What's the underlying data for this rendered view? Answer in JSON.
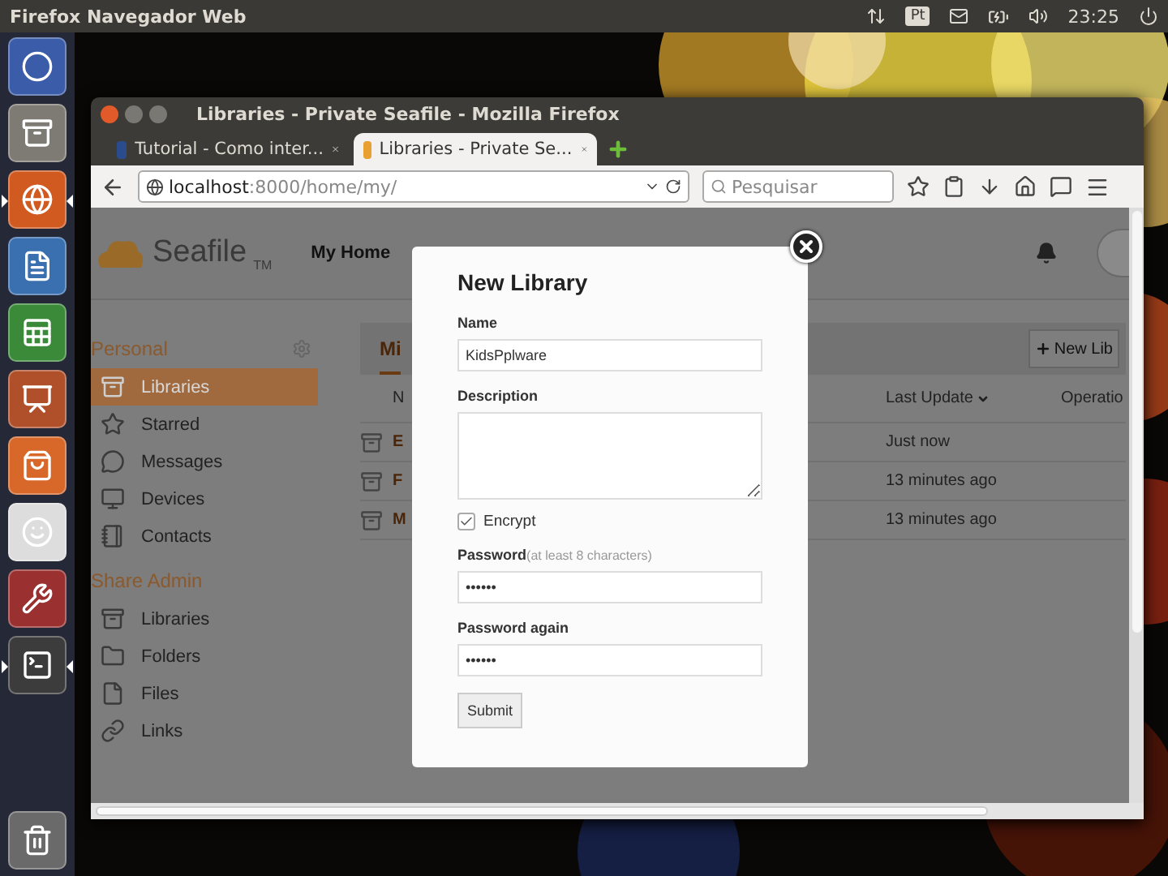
{
  "top_panel": {
    "app_title": "Firefox Navegador Web",
    "keyboard_layout": "Pt",
    "clock": "23:25"
  },
  "launcher": {
    "items": [
      {
        "kind": "dash",
        "running": false
      },
      {
        "kind": "files",
        "running": false
      },
      {
        "kind": "browser",
        "running": true
      },
      {
        "kind": "writer",
        "running": false
      },
      {
        "kind": "calc",
        "running": false
      },
      {
        "kind": "impress",
        "running": false
      },
      {
        "kind": "software",
        "running": false
      },
      {
        "kind": "shop",
        "running": false
      },
      {
        "kind": "settings",
        "running": false
      },
      {
        "kind": "terminal",
        "running": true
      },
      {
        "kind": "trash",
        "running": false
      }
    ]
  },
  "window": {
    "title": "Libraries - Private Seafile - Mozilla Firefox"
  },
  "tabs": [
    {
      "label": "Tutorial - Como inter...",
      "selected": false
    },
    {
      "label": "Libraries - Private Se...",
      "selected": true
    }
  ],
  "address": {
    "host": "localhost",
    "path": ":8000/home/my/"
  },
  "search": {
    "placeholder": "Pesquisar"
  },
  "seafile": {
    "logo": "Seafile",
    "trademark": "TM",
    "nav": [
      {
        "label": "My Home",
        "selected": true
      }
    ]
  },
  "sidebar": {
    "sections": [
      {
        "title": "Personal",
        "items": [
          {
            "kind": "library",
            "label": "Libraries",
            "selected": true
          },
          {
            "kind": "star",
            "label": "Starred",
            "selected": false
          },
          {
            "kind": "message",
            "label": "Messages",
            "selected": false
          },
          {
            "kind": "device",
            "label": "Devices",
            "selected": false
          },
          {
            "kind": "contact",
            "label": "Contacts",
            "selected": false
          }
        ]
      },
      {
        "title": "Share Admin",
        "items": [
          {
            "kind": "library",
            "label": "Libraries",
            "selected": false
          },
          {
            "kind": "folder",
            "label": "Folders",
            "selected": false
          },
          {
            "kind": "file",
            "label": "Files",
            "selected": false
          },
          {
            "kind": "link",
            "label": "Links",
            "selected": false
          }
        ]
      }
    ]
  },
  "main": {
    "tab": {
      "label": "Mi",
      "selected": true
    },
    "new_button": "New Lib",
    "table": {
      "columns": [
        "N",
        "Last Update",
        "Operatio"
      ],
      "rows": [
        {
          "name": "E",
          "updated": "Just now"
        },
        {
          "name": "F",
          "updated": "13 minutes ago"
        },
        {
          "name": "M",
          "updated": "13 minutes ago"
        }
      ]
    }
  },
  "dialog": {
    "title": "New Library",
    "fields": [
      {
        "kind": "text",
        "label": "Name",
        "value": "KidsPplware"
      },
      {
        "kind": "textarea",
        "label": "Description"
      },
      {
        "kind": "checkbox",
        "label": "Encrypt",
        "checked": true
      },
      {
        "kind": "password",
        "label": "Password",
        "hint": "(at least 8 characters)",
        "value": "••••••"
      },
      {
        "kind": "password",
        "label": "Password again",
        "value": "••••••"
      }
    ],
    "submit": "Submit"
  }
}
